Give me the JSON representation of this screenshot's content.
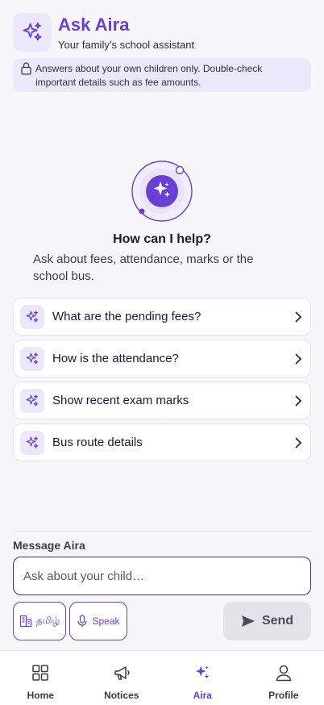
{
  "header": {
    "title": "Ask Aira",
    "subtitle": "Your family’s school assistant",
    "logo_icon": "sparkles-icon"
  },
  "banner": {
    "icon": "lock-icon",
    "text": "Answers about your own children only. Double-check important details such as fee amounts."
  },
  "empty_state": {
    "title": "How can I help?",
    "description": "Ask about fees, attendance, marks or the school bus."
  },
  "suggestions": [
    {
      "label": "What are the pending fees?"
    },
    {
      "label": "How is the attendance?"
    },
    {
      "label": "Show recent exam marks"
    },
    {
      "label": "Bus route details"
    }
  ],
  "composer": {
    "label": "Message Aira",
    "placeholder": "Ask about your child…",
    "language_button": "தமிழ்",
    "speak_button": "Speak",
    "send_button": "Send"
  },
  "nav": {
    "items": [
      {
        "label": "Home",
        "icon": "grid-icon"
      },
      {
        "label": "Notices",
        "icon": "megaphone-icon"
      },
      {
        "label": "Aira",
        "icon": "sparkles-icon"
      },
      {
        "label": "Profile",
        "icon": "user-icon"
      }
    ],
    "active": "Aira"
  },
  "colors": {
    "accent": "#6a3fd6",
    "accent_light": "#ece8fb",
    "background": "#f7f6fb",
    "send_disabled": "#e4e3ea"
  }
}
